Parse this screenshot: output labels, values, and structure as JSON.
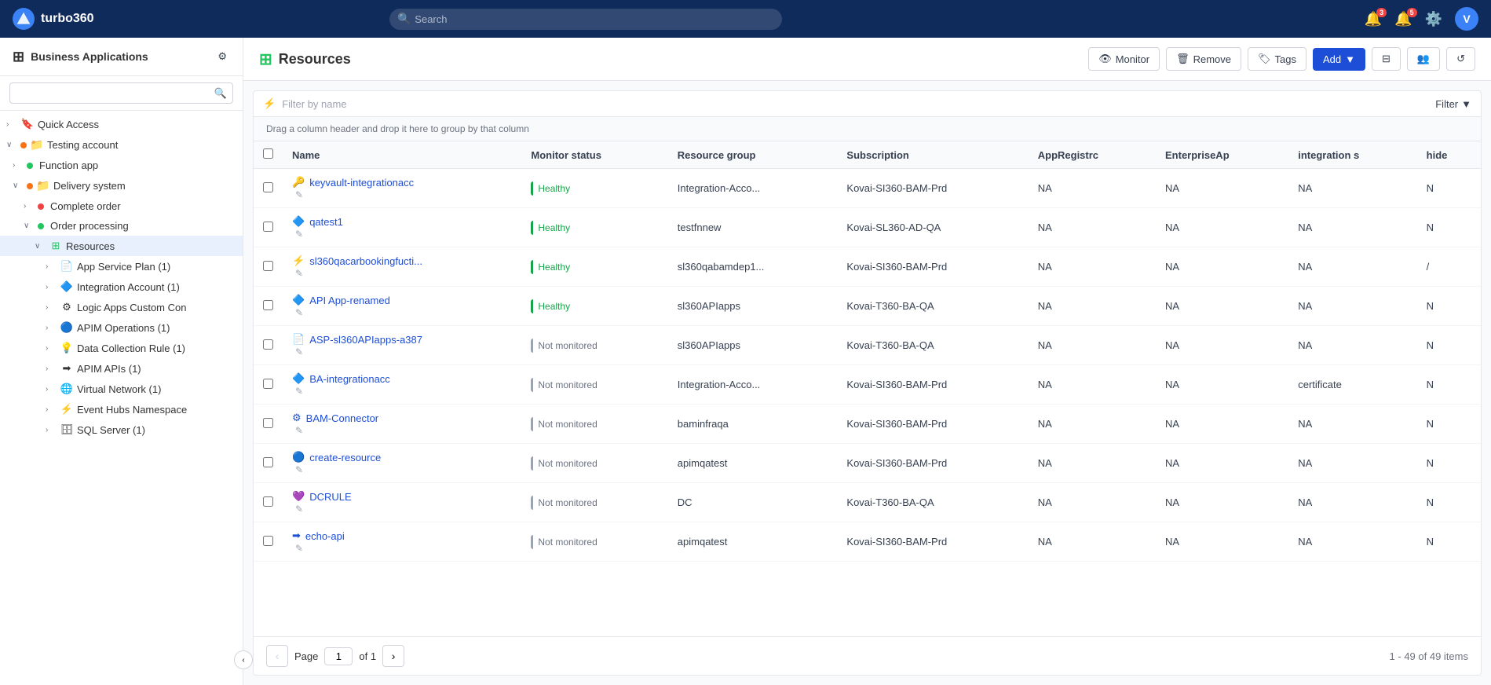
{
  "topnav": {
    "logo_text": "turbo360",
    "logo_letter": "T",
    "search_placeholder": "Search",
    "notification_badge": "3",
    "alert_badge": "5",
    "user_letter": "V"
  },
  "sidebar": {
    "title": "Business Applications",
    "search_placeholder": "",
    "quick_access": "Quick Access",
    "tree": [
      {
        "id": "quick-access",
        "label": "Quick Access",
        "level": 0,
        "icon": "🔖",
        "arrow": "›",
        "indent": 0
      },
      {
        "id": "testing-account",
        "label": "Testing account",
        "level": 0,
        "icon": "📁",
        "arrow": "∨",
        "indent": 1,
        "dot": "orange"
      },
      {
        "id": "function-app",
        "label": "Function app",
        "level": 1,
        "icon": "",
        "arrow": "›",
        "indent": 2,
        "dot": "green"
      },
      {
        "id": "delivery-system",
        "label": "Delivery system",
        "level": 1,
        "icon": "📁",
        "arrow": "∨",
        "indent": 2,
        "dot": "orange"
      },
      {
        "id": "complete-order",
        "label": "Complete order",
        "level": 2,
        "icon": "",
        "arrow": "›",
        "indent": 3,
        "dot": "red"
      },
      {
        "id": "order-processing",
        "label": "Order processing",
        "level": 2,
        "icon": "",
        "arrow": "∨",
        "indent": 3,
        "dot": "green"
      },
      {
        "id": "resources",
        "label": "Resources",
        "level": 3,
        "icon": "⊞",
        "arrow": "∨",
        "indent": 4,
        "active": true
      },
      {
        "id": "app-service-plan",
        "label": "App Service Plan (1)",
        "level": 4,
        "icon": "📄",
        "arrow": "›",
        "indent": 5
      },
      {
        "id": "integration-account",
        "label": "Integration Account (1)",
        "level": 4,
        "icon": "🔷",
        "arrow": "›",
        "indent": 5
      },
      {
        "id": "logic-apps-custom",
        "label": "Logic Apps Custom Conn",
        "level": 4,
        "icon": "⚙",
        "arrow": "›",
        "indent": 5
      },
      {
        "id": "apim-operations",
        "label": "APIM Operations (1)",
        "level": 4,
        "icon": "🔵",
        "arrow": "›",
        "indent": 5
      },
      {
        "id": "data-collection-rule",
        "label": "Data Collection Rule (1)",
        "level": 4,
        "icon": "💡",
        "arrow": "›",
        "indent": 5
      },
      {
        "id": "apim-apis",
        "label": "APIM APIs (1)",
        "level": 4,
        "icon": "➡",
        "arrow": "›",
        "indent": 5
      },
      {
        "id": "virtual-network",
        "label": "Virtual Network (1)",
        "level": 4,
        "icon": "🌐",
        "arrow": "›",
        "indent": 5
      },
      {
        "id": "event-hubs-namespace",
        "label": "Event Hubs Namespace",
        "level": 4,
        "icon": "⚡",
        "arrow": "›",
        "indent": 5
      },
      {
        "id": "sql-server",
        "label": "SQL Server (1)",
        "level": 4,
        "icon": "🗄",
        "arrow": "›",
        "indent": 5
      }
    ]
  },
  "content": {
    "title": "Resources",
    "title_icon": "⊞",
    "actions": {
      "monitor": "Monitor",
      "remove": "Remove",
      "tags": "Tags",
      "add": "Add",
      "filter": "Filter"
    },
    "filter_placeholder": "Filter by name",
    "drag_hint": "Drag a column header and drop it here to group by that column",
    "columns": [
      "Name",
      "Monitor status",
      "Resource group",
      "Subscription",
      "AppRegistrc",
      "EnterpriseAp",
      "integration s",
      "hide"
    ],
    "rows": [
      {
        "name": "keyvault-integrationacc",
        "status": "Healthy",
        "status_type": "healthy",
        "resource_group": "Integration-Acco...",
        "subscription": "Kovai-SI360-BAM-Prd",
        "app_reg": "NA",
        "enterprise": "NA",
        "integration": "NA",
        "hide": "N",
        "icon": "🔑"
      },
      {
        "name": "qatest1",
        "status": "Healthy",
        "status_type": "healthy",
        "resource_group": "testfnnew",
        "subscription": "Kovai-SL360-AD-QA",
        "app_reg": "NA",
        "enterprise": "NA",
        "integration": "NA",
        "hide": "N",
        "icon": "🔷"
      },
      {
        "name": "sl360qacarbookingfucti...",
        "status": "Healthy",
        "status_type": "healthy",
        "resource_group": "sl360qabamdep1...",
        "subscription": "Kovai-SI360-BAM-Prd",
        "app_reg": "NA",
        "enterprise": "NA",
        "integration": "NA",
        "hide": "/",
        "icon": "⚡"
      },
      {
        "name": "API App-renamed",
        "status": "Healthy",
        "status_type": "healthy",
        "resource_group": "sl360APIapps",
        "subscription": "Kovai-T360-BA-QA",
        "app_reg": "NA",
        "enterprise": "NA",
        "integration": "NA",
        "hide": "N",
        "icon": "🔷"
      },
      {
        "name": "ASP-sl360APIapps-a387",
        "status": "Not monitored",
        "status_type": "not-monitored",
        "resource_group": "sl360APIapps",
        "subscription": "Kovai-T360-BA-QA",
        "app_reg": "NA",
        "enterprise": "NA",
        "integration": "NA",
        "hide": "N",
        "icon": "📄"
      },
      {
        "name": "BA-integrationacc",
        "status": "Not monitored",
        "status_type": "not-monitored",
        "resource_group": "Integration-Acco...",
        "subscription": "Kovai-SI360-BAM-Prd",
        "app_reg": "NA",
        "enterprise": "NA",
        "integration": "certificate",
        "hide": "N",
        "icon": "🔷"
      },
      {
        "name": "BAM-Connector",
        "status": "Not monitored",
        "status_type": "not-monitored",
        "resource_group": "baminfraqa",
        "subscription": "Kovai-SI360-BAM-Prd",
        "app_reg": "NA",
        "enterprise": "NA",
        "integration": "NA",
        "hide": "N",
        "icon": "⚙"
      },
      {
        "name": "create-resource",
        "status": "Not monitored",
        "status_type": "not-monitored",
        "resource_group": "apimqatest",
        "subscription": "Kovai-SI360-BAM-Prd",
        "app_reg": "NA",
        "enterprise": "NA",
        "integration": "NA",
        "hide": "N",
        "icon": "🔵"
      },
      {
        "name": "DCRULE",
        "status": "Not monitored",
        "status_type": "not-monitored",
        "resource_group": "DC",
        "subscription": "Kovai-T360-BA-QA",
        "app_reg": "NA",
        "enterprise": "NA",
        "integration": "NA",
        "hide": "N",
        "icon": "💜"
      },
      {
        "name": "echo-api",
        "status": "Not monitored",
        "status_type": "not-monitored",
        "resource_group": "apimqatest",
        "subscription": "Kovai-SI360-BAM-Prd",
        "app_reg": "NA",
        "enterprise": "NA",
        "integration": "NA",
        "hide": "N",
        "icon": "➡"
      }
    ],
    "pagination": {
      "page_label": "Page",
      "current_page": "1",
      "of_label": "of 1",
      "items_info": "1 - 49 of 49 items"
    }
  }
}
